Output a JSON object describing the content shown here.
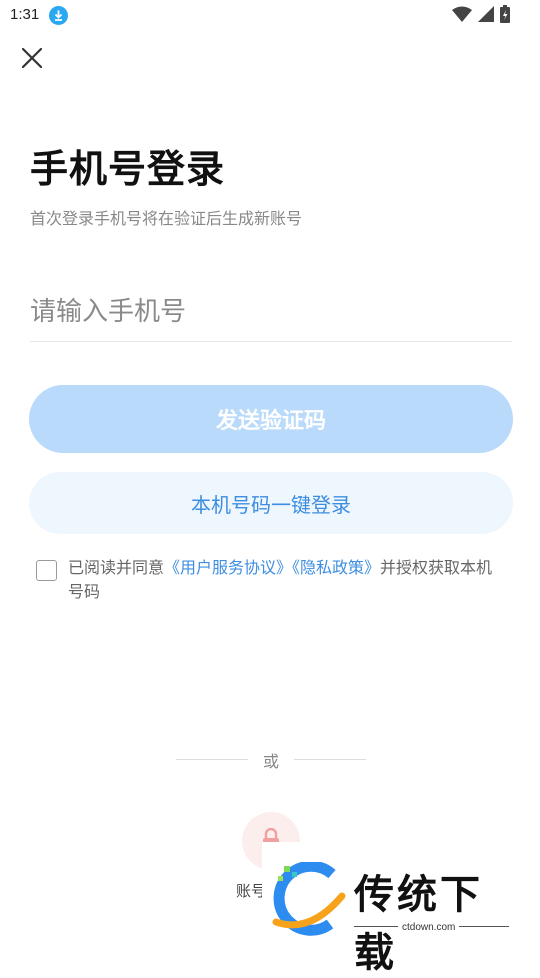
{
  "status_bar": {
    "time": "1:31"
  },
  "title": "手机号登录",
  "subtitle": "首次登录手机号将在验证后生成新账号",
  "phone_input": {
    "placeholder": "请输入手机号",
    "value": ""
  },
  "buttons": {
    "send_code": "发送验证码",
    "one_key_login": "本机号码一键登录"
  },
  "agreement": {
    "prefix": "已阅读并同意",
    "link_user": "《用户服务协议》",
    "link_privacy": "《隐私政策》",
    "suffix": "并授权获取本机号码",
    "checked": false
  },
  "or_text": "或",
  "account_login": {
    "label": "账号"
  },
  "watermark": {
    "name": "传统下载",
    "url": "ctdown.com"
  },
  "colors": {
    "primary": "#3d8ee0",
    "send_disabled": "#b9dafb",
    "one_key_bg": "#eef6fe",
    "account_bg": "#fdeeee",
    "account_icon": "#f0a0a0"
  },
  "icons": [
    "download-icon",
    "wifi-icon",
    "signal-icon",
    "battery-icon",
    "close-icon",
    "lock-icon"
  ]
}
